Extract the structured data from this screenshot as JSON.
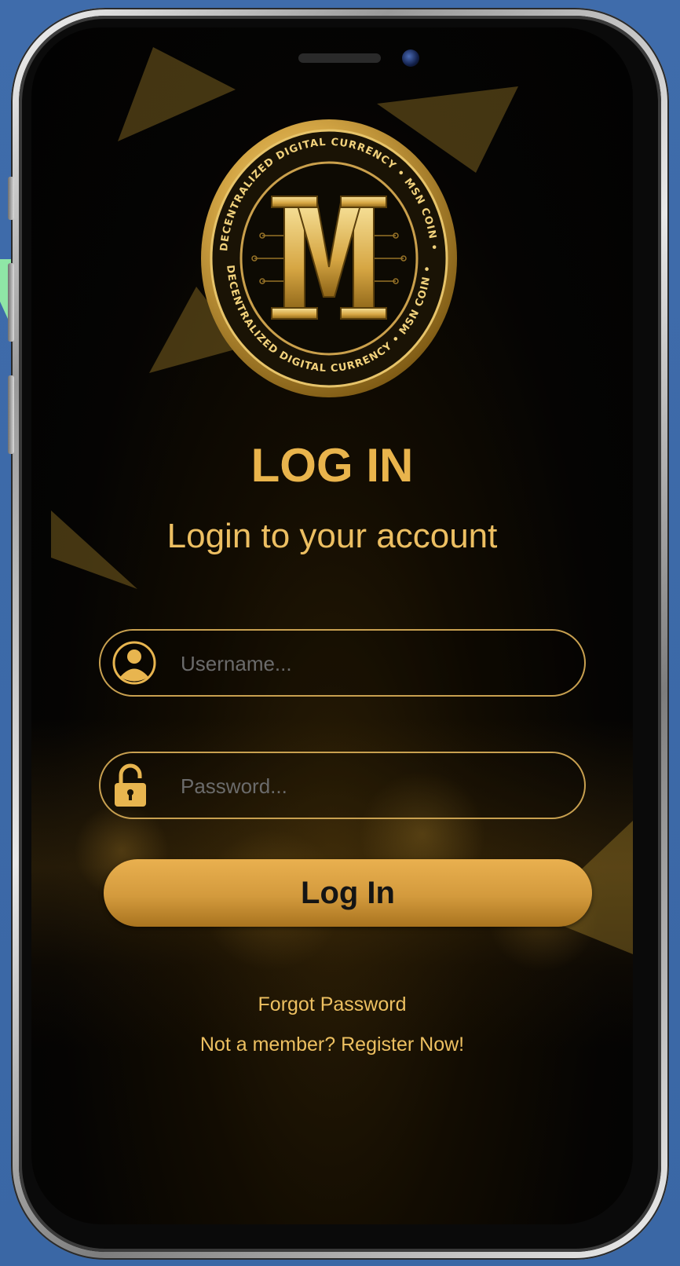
{
  "header": {
    "title": "LOG IN",
    "subtitle": "Login to your account"
  },
  "logo": {
    "name": "MSN Coin logo",
    "ring_text_top": "DECENTRALIZED DIGITAL CURRENCY • MSN COIN •",
    "ring_text_bottom": "DECENTRALIZED DIGITAL CURRENCY • MSN COIN •"
  },
  "form": {
    "username_placeholder": "Username...",
    "username_value": "",
    "password_placeholder": "Password...",
    "password_value": "",
    "submit_label": "Log In"
  },
  "links": {
    "forgot_password": "Forgot Password",
    "register": "Not a member? Register Now!"
  },
  "icons": {
    "username": "user-avatar-icon",
    "password": "lock-icon"
  },
  "colors": {
    "accent_gold": "#e9b44c",
    "button_gold": "#d39a3d",
    "screen_bg": "#050403",
    "page_bg": "#3d6aa8"
  }
}
